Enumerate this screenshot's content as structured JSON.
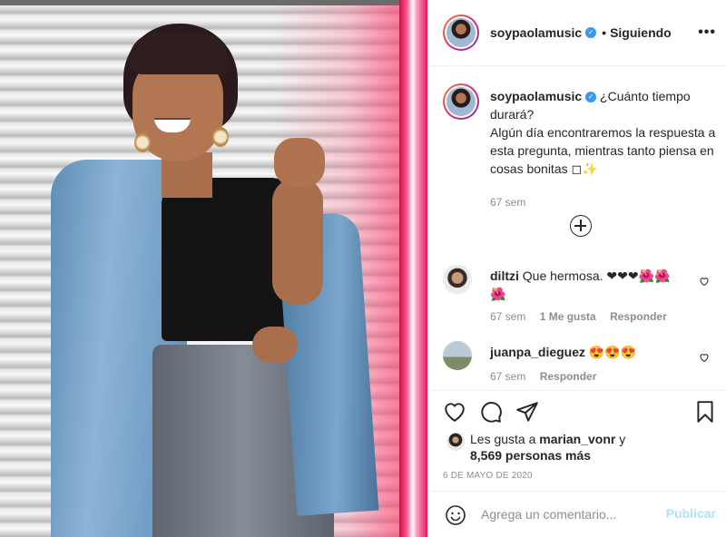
{
  "post": {
    "username": "soypaolamusic",
    "verified_mark": "✓",
    "separator": "•",
    "follow_status": "Siguiendo",
    "more_glyph": "•••",
    "caption_line1": "¿Cuánto tiempo durará?",
    "caption_line2": "Algún día encontraremos la respuesta a esta pregunta, mientras tanto piensa en cosas bonitas",
    "caption_emoji": "◻✨",
    "caption_time": "67 sem"
  },
  "comments": [
    {
      "username": "diltzi",
      "text": "Que hermosa. ❤❤❤🌺🌺🌺",
      "time": "67 sem",
      "likes": "1 Me gusta",
      "reply": "Responder"
    },
    {
      "username": "juanpa_dieguez",
      "text": "😍😍😍",
      "time": "67 sem",
      "reply": "Responder"
    }
  ],
  "likes": {
    "prefix": "Les gusta a",
    "user": "marian_vonr",
    "conj": "y",
    "others": "8,569 personas más"
  },
  "date": "6 DE MAYO DE 2020",
  "add_comment": {
    "placeholder": "Agrega un comentario...",
    "submit_label": "Publicar"
  },
  "colors": {
    "brand_link": "#b2dffc",
    "verified": "#3897f0",
    "muted": "#8e8e8e"
  }
}
